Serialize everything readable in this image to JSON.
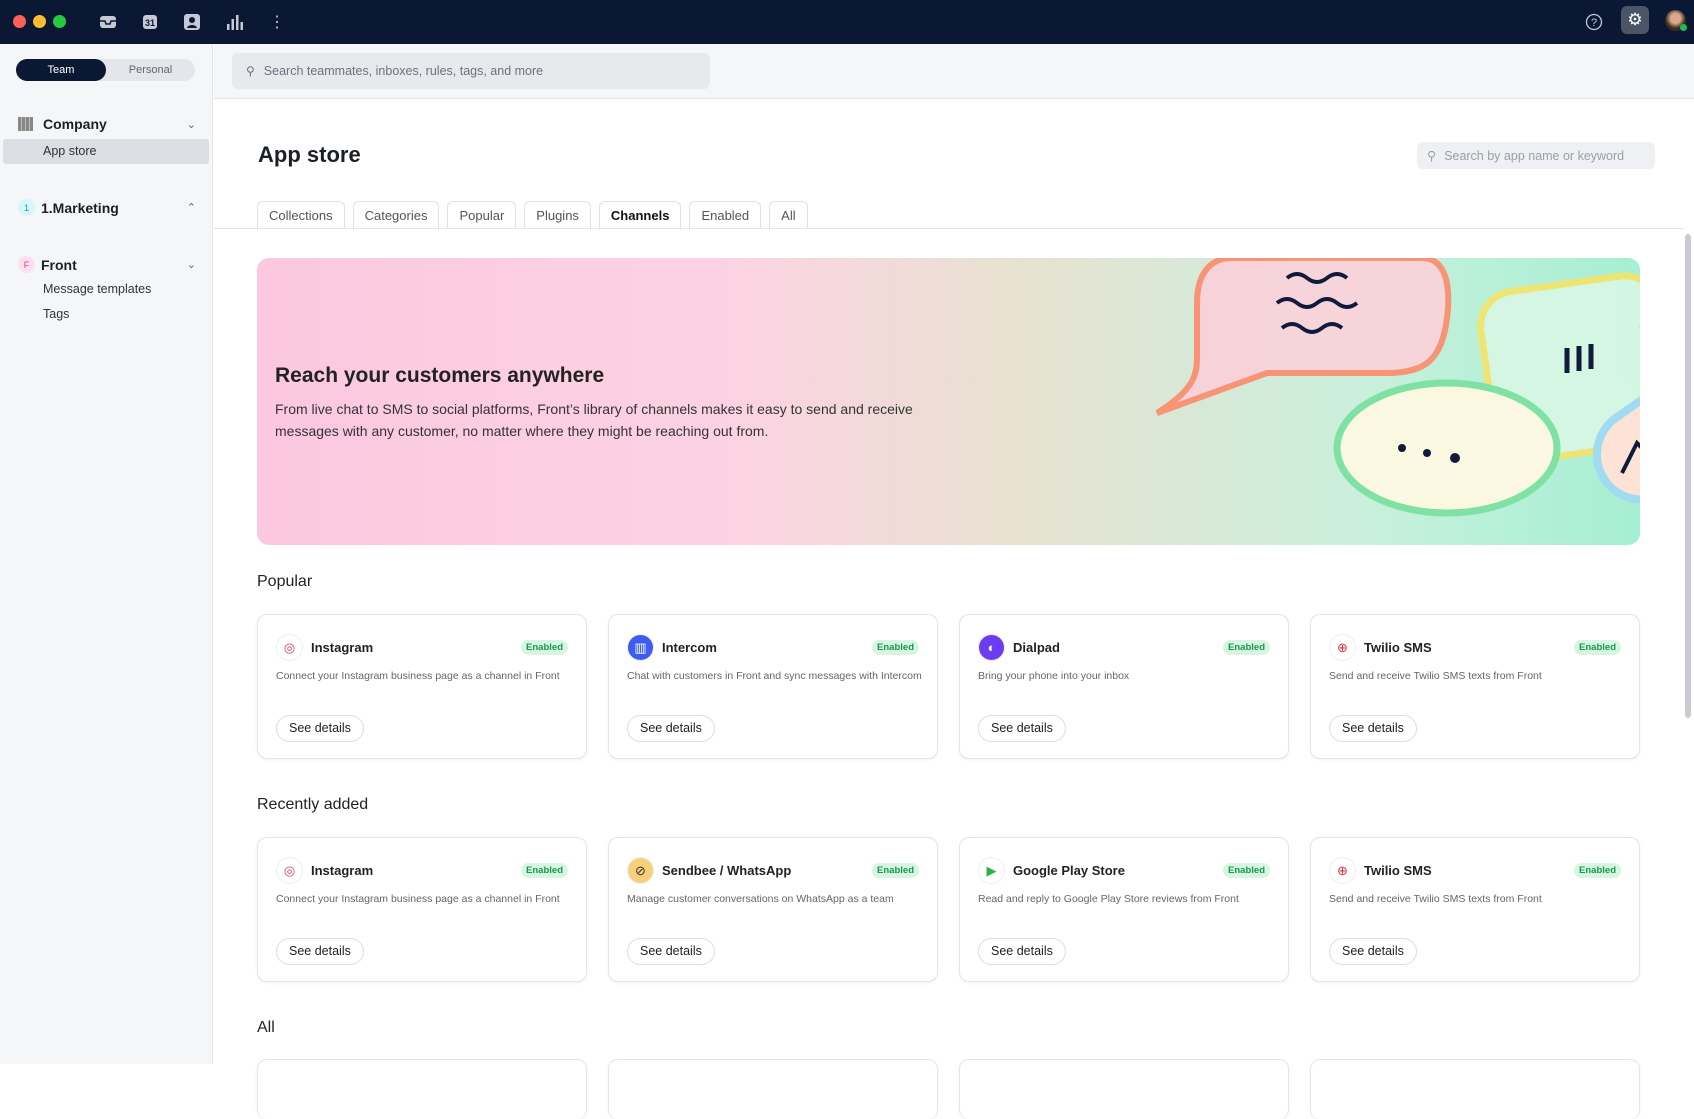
{
  "topbar": {
    "calendar_day": "31"
  },
  "sidebar": {
    "toggle": {
      "team": "Team",
      "personal": "Personal"
    },
    "groups": [
      {
        "label": "Company",
        "items": [
          "App store"
        ]
      },
      {
        "label": "1.Marketing",
        "badge": "1",
        "items": []
      },
      {
        "label": "Front",
        "badge": "F",
        "items": [
          "Message templates",
          "Tags"
        ]
      }
    ]
  },
  "header": {
    "search_placeholder": "Search teammates, inboxes, rules, tags, and more"
  },
  "page": {
    "title": "App store",
    "search_placeholder": "Search by app name or keyword",
    "tabs": [
      "Collections",
      "Categories",
      "Popular",
      "Plugins",
      "Channels",
      "Enabled",
      "All"
    ],
    "active_tab": "Channels"
  },
  "banner": {
    "title": "Reach your customers anywhere",
    "text": "From live chat to SMS to social platforms, Front’s library of channels makes it easy to send and receive messages with any customer, no matter where they might be reaching out from."
  },
  "sections": [
    {
      "title": "Popular",
      "cards": [
        {
          "name": "Instagram",
          "icon": "instagram-icon",
          "status": "Enabled",
          "desc": "Connect your Instagram business page as a channel in Front",
          "button": "See details"
        },
        {
          "name": "Intercom",
          "icon": "intercom-icon",
          "status": "Enabled",
          "desc": "Chat with customers in Front and sync messages with Intercom",
          "button": "See details"
        },
        {
          "name": "Dialpad",
          "icon": "dialpad-icon",
          "status": "Enabled",
          "desc": "Bring your phone into your inbox",
          "button": "See details"
        },
        {
          "name": "Twilio SMS",
          "icon": "twilio-icon",
          "status": "Enabled",
          "desc": "Send and receive Twilio SMS texts from Front",
          "button": "See details"
        }
      ]
    },
    {
      "title": "Recently added",
      "cards": [
        {
          "name": "Instagram",
          "icon": "instagram-icon",
          "status": "Enabled",
          "desc": "Connect your Instagram business page as a channel in Front",
          "button": "See details"
        },
        {
          "name": "Sendbee / WhatsApp",
          "icon": "sendbee-icon",
          "status": "Enabled",
          "desc": "Manage customer conversations on WhatsApp as a team",
          "button": "See details"
        },
        {
          "name": "Google Play Store",
          "icon": "google-play-icon",
          "status": "Enabled",
          "desc": "Read and reply to Google Play Store reviews from Front",
          "button": "See details"
        },
        {
          "name": "Twilio SMS",
          "icon": "twilio-icon",
          "status": "Enabled",
          "desc": "Send and receive Twilio SMS texts from Front",
          "button": "See details"
        }
      ]
    },
    {
      "title": "All",
      "cards": []
    }
  ],
  "colors": {
    "topbar": "#0b1833",
    "enabled": "#149a4a"
  }
}
